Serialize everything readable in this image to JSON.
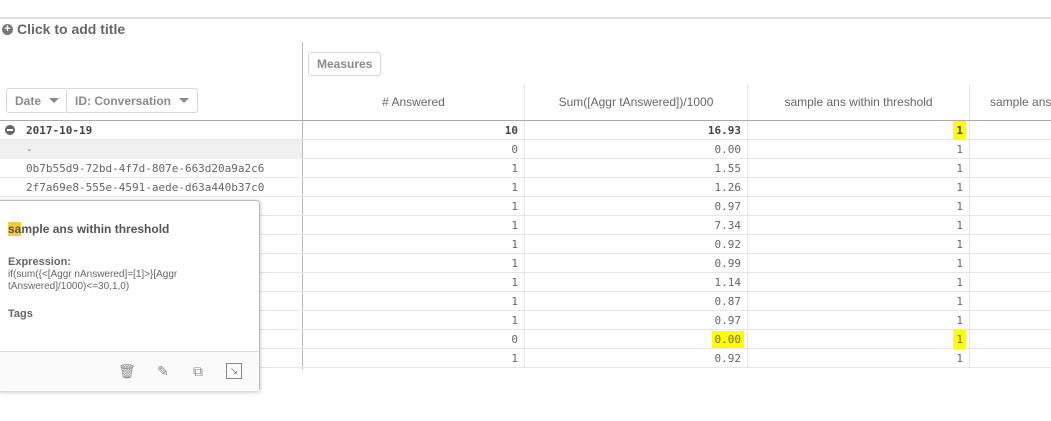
{
  "title": "Click to add title",
  "measures_button": "Measures",
  "dimensions": [
    {
      "label": "Date"
    },
    {
      "label": "ID: Conversation"
    }
  ],
  "columns": [
    "# Answered",
    "Sum([Aggr tAnswered])/1000",
    "sample ans within threshold",
    "sample answ"
  ],
  "total": {
    "label": "2017-10-19",
    "answered": "10",
    "sum": "16.93",
    "within": "1"
  },
  "rows": [
    {
      "label": "-",
      "answered": "0",
      "sum": "0.00",
      "within": "1"
    },
    {
      "label": "0b7b55d9-72bd-4f7d-807e-663d20a9a2c6",
      "answered": "1",
      "sum": "1.55",
      "within": "1"
    },
    {
      "label": "2f7a69e8-555e-4591-aede-d63a440b37c0",
      "answered": "1",
      "sum": "1.26",
      "within": "1"
    },
    {
      "label": "",
      "answered": "1",
      "sum": "0.97",
      "within": "1"
    },
    {
      "label": "",
      "answered": "1",
      "sum": "7.34",
      "within": "1"
    },
    {
      "label": "",
      "answered": "1",
      "sum": "0.92",
      "within": "1"
    },
    {
      "label": "",
      "answered": "1",
      "sum": "0.99",
      "within": "1"
    },
    {
      "label": "",
      "answered": "1",
      "sum": "1.14",
      "within": "1"
    },
    {
      "label": "",
      "answered": "1",
      "sum": "0.87",
      "within": "1"
    },
    {
      "label": "",
      "answered": "1",
      "sum": "0.97",
      "within": "1"
    },
    {
      "label": "",
      "answered": "0",
      "sum": "0.00",
      "within": "1"
    },
    {
      "label": "",
      "answered": "1",
      "sum": "0.92",
      "within": "1"
    }
  ],
  "popup": {
    "title_mark": "sa",
    "title_rest": "mple ans within threshold",
    "expression_label": "Expression:",
    "expression": "if(sum({<[Aggr nAnswered]=[1]>}[Aggr tAnswered]/1000)<=30,1,0)",
    "tags_label": "Tags",
    "icons": [
      "trash-icon",
      "edit-icon",
      "duplicate-icon",
      "replace-icon"
    ]
  },
  "highlight_color": "#ffff00"
}
